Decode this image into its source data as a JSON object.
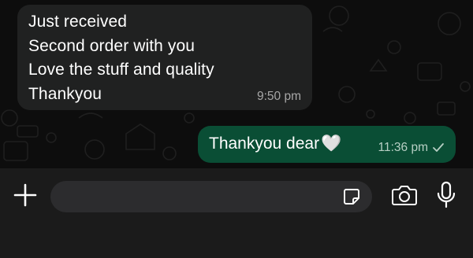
{
  "messages": {
    "incoming": {
      "lines": [
        "Just received",
        "Second order with you",
        "Love the stuff and quality",
        "Thankyou"
      ],
      "time": "9:50 pm"
    },
    "outgoing": {
      "text": "Thankyou dear",
      "emoji": "🤍",
      "time": "11:36 pm",
      "status_icon": "single-check-icon"
    }
  },
  "composer": {
    "placeholder": "",
    "plus_icon": "plus-icon",
    "sticker_icon": "sticker-icon",
    "camera_icon": "camera-icon",
    "mic_icon": "microphone-icon"
  },
  "colors": {
    "chat_bg": "#0d0d0d",
    "incoming_bubble": "#202121",
    "outgoing_bubble": "#0a4e35",
    "composer_bg": "#1b1b1b",
    "input_bg": "#2c2c2e"
  }
}
